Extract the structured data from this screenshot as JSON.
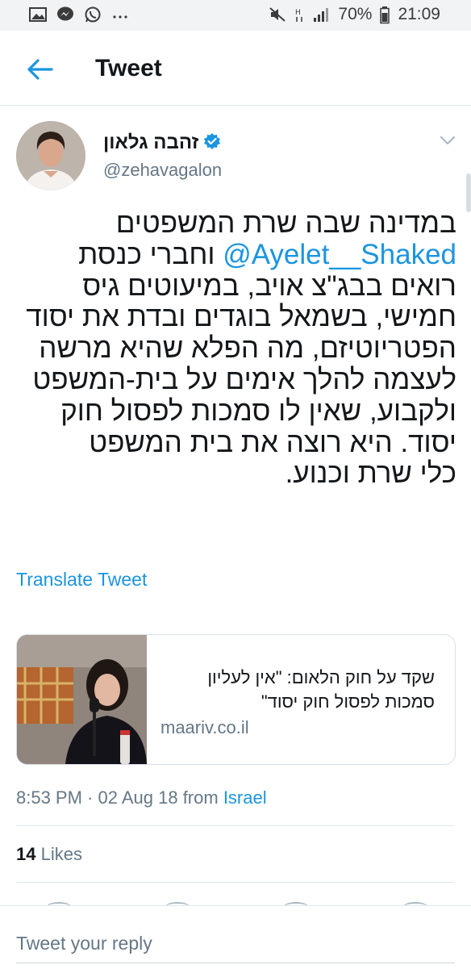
{
  "status_bar": {
    "battery": "70%",
    "time": "21:09",
    "notification_icons": [
      "gallery-icon",
      "messenger-icon",
      "whatsapp-icon",
      "more-icon"
    ],
    "system_icons": [
      "mute-icon",
      "data-icon",
      "signal-icon",
      "battery-icon"
    ]
  },
  "header": {
    "title": "Tweet"
  },
  "tweet": {
    "author_name": "זהבה גלאון",
    "verified": true,
    "handle": "@zehavagalon",
    "lines": [
      {
        "before": "במדינה שבה שרת המשפטים"
      },
      {
        "mention": "@Ayelet__Shaked",
        "after": " וחברי כנסת"
      },
      {
        "before": "רואים בבג\"צ אויב, במיעוטים גיס"
      },
      {
        "before": "חמישי, בשמאל בוגדים ובדת את יסוד"
      },
      {
        "before": "הפטריוטיזם, מה הפלא שהיא מרשה"
      },
      {
        "before": "לעצמה להלך אימים על בית-המשפט"
      },
      {
        "before": "ולקבוע, שאין לו סמכות לפסול חוק"
      },
      {
        "before": "יסוד. היא רוצה את בית המשפט"
      },
      {
        "before": "כלי שרת וכנוע."
      }
    ],
    "translate_label": "Translate Tweet",
    "card": {
      "title_line1": "שקד על חוק הלאום: \"אין לעליון",
      "title_line2": "סמכות לפסול חוק יסוד\"",
      "domain": "maariv.co.il"
    },
    "time": "8:53 PM · 02 Aug 18 from ",
    "place": "Israel",
    "likes_count": "14",
    "likes_label": "Likes"
  },
  "reply": {
    "placeholder": "Tweet your reply"
  },
  "colors": {
    "accent": "#1b95e0",
    "text": "#14171a",
    "muted": "#657786",
    "divider": "#e1e8ed"
  }
}
